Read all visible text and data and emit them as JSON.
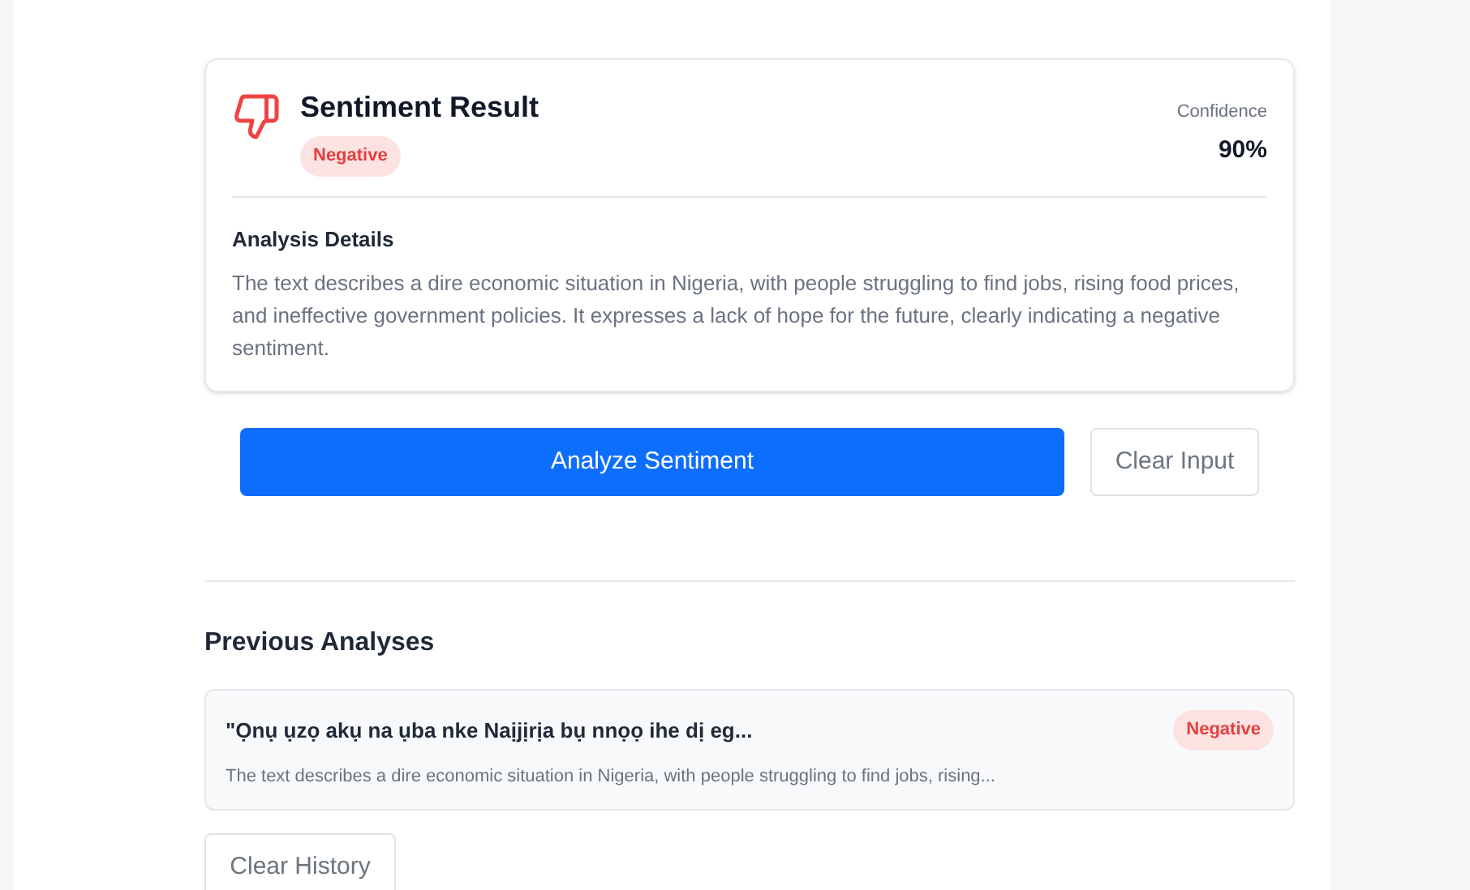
{
  "result": {
    "title": "Sentiment Result",
    "kind": "negative",
    "badge": "Negative",
    "confidence_label": "Confidence",
    "confidence": "90%",
    "details_heading": "Analysis Details",
    "details": "The text describes a dire economic situation in Nigeria, with people struggling to find jobs, rising food prices, and ineffective government policies. It expresses a lack of hope for the future, clearly indicating a negative sentiment."
  },
  "buttons": {
    "analyze": "Analyze Sentiment",
    "clear": "Clear Input"
  },
  "history": {
    "heading": "Previous Analyses",
    "items": [
      {
        "text": "\"Ọnụ ụzọ akụ na ụba nke Naịjịrịa bụ nnọọ ihe dị eg...",
        "kind": "negative",
        "badge": "Negative",
        "summary": "The text describes a dire economic situation in Nigeria, with people struggling to find jobs, rising..."
      }
    ],
    "clear": "Clear History"
  }
}
